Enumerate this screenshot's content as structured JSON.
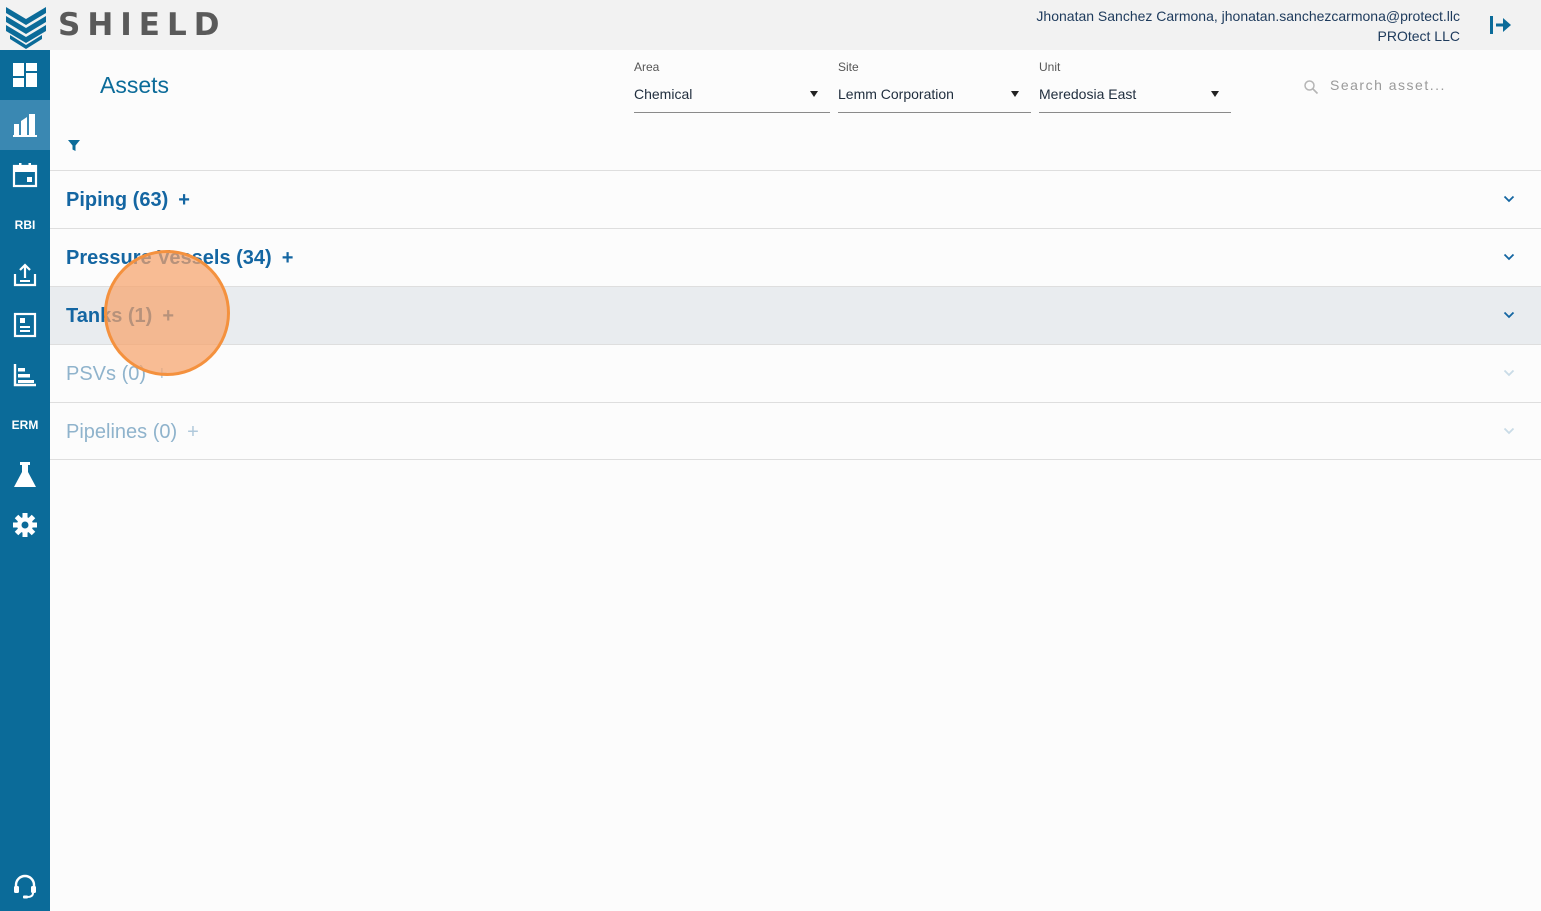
{
  "app": {
    "brand": "SHIELD",
    "user_line": "Jhonatan Sanchez Carmona, jhonatan.sanchezcarmona@protect.llc",
    "company": "PROtect LLC",
    "logout_icon": "logout-icon"
  },
  "sidebar": {
    "items": [
      {
        "name": "dashboard",
        "icon": "dashboard-icon"
      },
      {
        "name": "assets",
        "icon": "assets-icon",
        "active": true
      },
      {
        "name": "calendar",
        "icon": "calendar-icon"
      },
      {
        "name": "rbi",
        "label": "RBI"
      },
      {
        "name": "upload",
        "icon": "upload-icon"
      },
      {
        "name": "reports",
        "icon": "report-icon"
      },
      {
        "name": "charts",
        "icon": "chart-icon"
      },
      {
        "name": "erm",
        "label": "ERM"
      },
      {
        "name": "lab",
        "icon": "flask-icon"
      },
      {
        "name": "settings",
        "icon": "gear-icon"
      },
      {
        "name": "support",
        "icon": "headset-icon"
      }
    ]
  },
  "page": {
    "title": "Assets"
  },
  "filters": {
    "area": {
      "label": "Area",
      "value": "Chemical"
    },
    "site": {
      "label": "Site",
      "value": "Lemm Corporation"
    },
    "unit": {
      "label": "Unit",
      "value": "Meredosia East"
    },
    "search_placeholder": "Search asset..."
  },
  "accordion": [
    {
      "title": "Piping (63)",
      "plus": "+"
    },
    {
      "title": "Pressure Vessels (34)",
      "plus": "+"
    },
    {
      "title": "Tanks (1)",
      "plus": "+"
    },
    {
      "title": "PSVs (0)",
      "plus": "+"
    },
    {
      "title": "Pipelines (0)",
      "plus": "+"
    }
  ],
  "colors": {
    "primary": "#0b6b99",
    "sidebar_active": "#3a88b2",
    "title_blue": "#1466a2",
    "ripple": "#f4913e"
  }
}
